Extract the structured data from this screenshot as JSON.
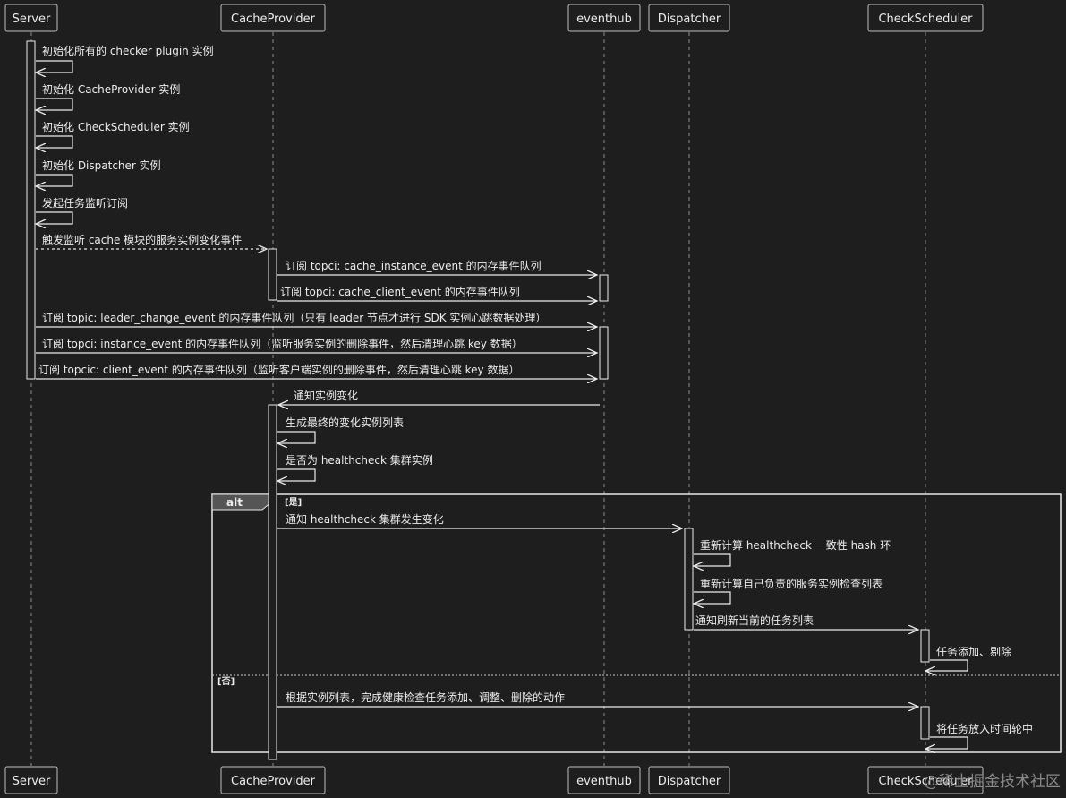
{
  "participants": [
    {
      "id": "server",
      "label": "Server"
    },
    {
      "id": "cache",
      "label": "CacheProvider"
    },
    {
      "id": "eventhub",
      "label": "eventhub"
    },
    {
      "id": "dispatcher",
      "label": "Dispatcher"
    },
    {
      "id": "scheduler",
      "label": "CheckScheduler"
    }
  ],
  "messages": [
    {
      "id": "m1",
      "from": "server",
      "to": "server",
      "text": "初始化所有的 checker plugin 实例",
      "self": true
    },
    {
      "id": "m2",
      "from": "server",
      "to": "server",
      "text": "初始化 CacheProvider 实例",
      "self": true
    },
    {
      "id": "m3",
      "from": "server",
      "to": "server",
      "text": "初始化 CheckScheduler 实例",
      "self": true
    },
    {
      "id": "m4",
      "from": "server",
      "to": "server",
      "text": "初始化 Dispatcher 实例",
      "self": true
    },
    {
      "id": "m5",
      "from": "server",
      "to": "server",
      "text": "发起任务监听订阅",
      "self": true
    },
    {
      "id": "m6",
      "from": "server",
      "to": "cache",
      "text": "触发监听 cache 模块的服务实例变化事件",
      "dashed": true
    },
    {
      "id": "m7",
      "from": "cache",
      "to": "eventhub",
      "text": "订阅 topci: cache_instance_event 的内存事件队列"
    },
    {
      "id": "m8",
      "from": "cache",
      "to": "eventhub",
      "text": "订阅 topci: cache_client_event 的内存事件队列"
    },
    {
      "id": "m9",
      "from": "server",
      "to": "eventhub",
      "text": "订阅 topic: leader_change_event 的内存事件队列（只有 leader 节点才进行 SDK 实例心跳数据处理）"
    },
    {
      "id": "m10",
      "from": "server",
      "to": "eventhub",
      "text": "订阅 topci: instance_event 的内存事件队列（监听服务实例的删除事件，然后清理心跳 key 数据）"
    },
    {
      "id": "m11",
      "from": "server",
      "to": "eventhub",
      "text": "订阅 topcic: client_event 的内存事件队列（监听客户端实例的删除事件，然后清理心跳 key 数据）"
    },
    {
      "id": "m12",
      "from": "eventhub",
      "to": "cache",
      "text": "通知实例变化"
    },
    {
      "id": "m13",
      "from": "cache",
      "to": "cache",
      "text": "生成最终的变化实例列表",
      "self": true
    },
    {
      "id": "m14",
      "from": "cache",
      "to": "cache",
      "text": "是否为 healthcheck 集群实例",
      "self": true
    },
    {
      "id": "m15",
      "from": "cache",
      "to": "dispatcher",
      "text": "通知 healthcheck 集群发生变化"
    },
    {
      "id": "m16",
      "from": "dispatcher",
      "to": "dispatcher",
      "text": "重新计算 healthcheck 一致性 hash 环",
      "self": true
    },
    {
      "id": "m17",
      "from": "dispatcher",
      "to": "dispatcher",
      "text": "重新计算自己负责的服务实例检查列表",
      "self": true
    },
    {
      "id": "m18",
      "from": "dispatcher",
      "to": "scheduler",
      "text": "通知刷新当前的任务列表"
    },
    {
      "id": "m19",
      "from": "scheduler",
      "to": "scheduler",
      "text": "任务添加、剔除",
      "self": true
    },
    {
      "id": "m20",
      "from": "cache",
      "to": "scheduler",
      "text": "根据实例列表，完成健康检查任务添加、调整、删除的动作"
    },
    {
      "id": "m21",
      "from": "scheduler",
      "to": "scheduler",
      "text": "将任务放入时间轮中",
      "self": true
    }
  ],
  "alt_fragment": {
    "keyword": "alt",
    "branches": [
      {
        "condition": "[是]"
      },
      {
        "condition": "[否]"
      }
    ]
  },
  "watermark": "@稀土掘金技术社区"
}
